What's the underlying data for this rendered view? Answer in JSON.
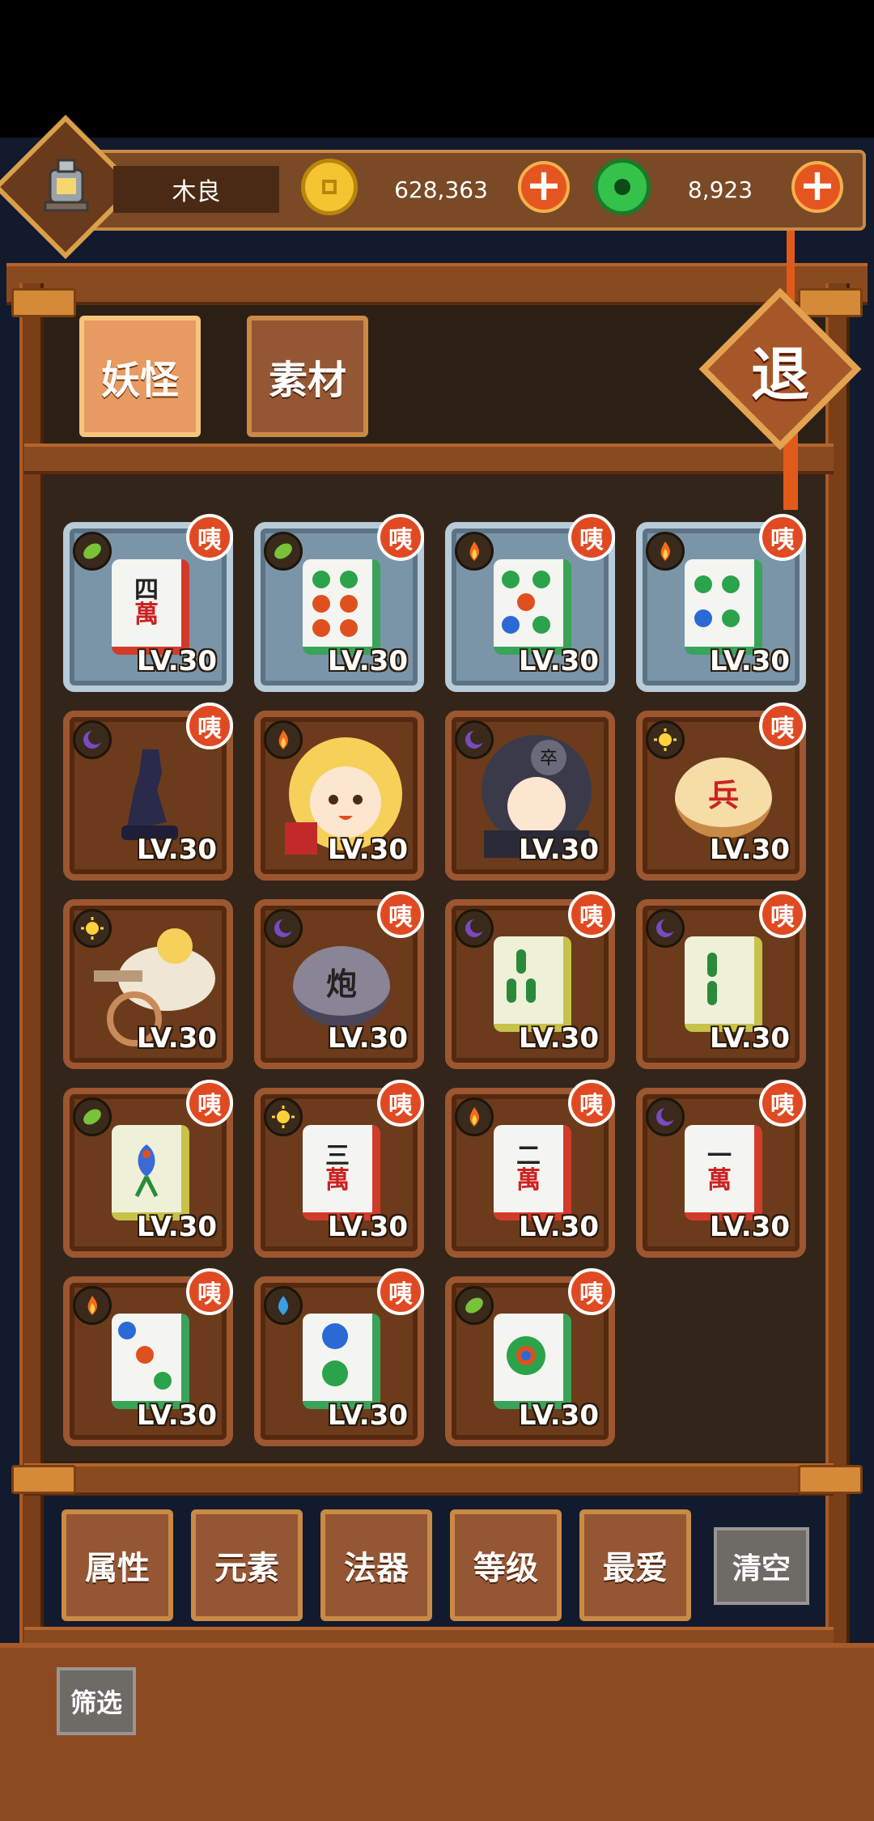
{
  "player": {
    "name": "木良"
  },
  "currency": {
    "coins": "628,363",
    "jade": "8,923"
  },
  "tabs": [
    {
      "label": "妖怪",
      "active": true
    },
    {
      "label": "素材",
      "active": false
    }
  ],
  "exit_label": "退",
  "cards": [
    {
      "level": "LV.30",
      "badge": "咦",
      "element": "leaf",
      "frame": "steel",
      "content": "mahjong-4-wan"
    },
    {
      "level": "LV.30",
      "badge": "咦",
      "element": "leaf",
      "frame": "steel",
      "content": "mahjong-6-dot"
    },
    {
      "level": "LV.30",
      "badge": "咦",
      "element": "fire",
      "frame": "steel",
      "content": "mahjong-5-dot"
    },
    {
      "level": "LV.30",
      "badge": "咦",
      "element": "fire",
      "frame": "steel",
      "content": "mahjong-4-dot"
    },
    {
      "level": "LV.30",
      "badge": "咦",
      "element": "moon",
      "frame": "wood",
      "content": "chess-knight"
    },
    {
      "level": "LV.30",
      "badge": "",
      "element": "fire",
      "frame": "wood",
      "content": "blonde-girl"
    },
    {
      "level": "LV.30",
      "badge": "",
      "element": "moon",
      "frame": "wood",
      "content": "dark-warrior"
    },
    {
      "level": "LV.30",
      "badge": "咦",
      "element": "sun",
      "frame": "wood",
      "content": "xiangqi-bing"
    },
    {
      "level": "LV.30",
      "badge": "",
      "element": "sun",
      "frame": "wood",
      "content": "cannon-boy"
    },
    {
      "level": "LV.30",
      "badge": "咦",
      "element": "moon",
      "frame": "wood",
      "content": "xiangqi-pao"
    },
    {
      "level": "LV.30",
      "badge": "咦",
      "element": "moon",
      "frame": "wood",
      "content": "mahjong-3-bamboo"
    },
    {
      "level": "LV.30",
      "badge": "咦",
      "element": "moon",
      "frame": "wood",
      "content": "mahjong-2-bamboo"
    },
    {
      "level": "LV.30",
      "badge": "咦",
      "element": "leaf",
      "frame": "wood",
      "content": "mahjong-1-bamboo"
    },
    {
      "level": "LV.30",
      "badge": "咦",
      "element": "sun",
      "frame": "wood",
      "content": "mahjong-3-wan"
    },
    {
      "level": "LV.30",
      "badge": "咦",
      "element": "fire",
      "frame": "wood",
      "content": "mahjong-2-wan"
    },
    {
      "level": "LV.30",
      "badge": "咦",
      "element": "moon",
      "frame": "wood",
      "content": "mahjong-1-wan"
    },
    {
      "level": "LV.30",
      "badge": "咦",
      "element": "fire",
      "frame": "wood",
      "content": "mahjong-3-dot"
    },
    {
      "level": "LV.30",
      "badge": "咦",
      "element": "water",
      "frame": "wood",
      "content": "mahjong-2-dot"
    },
    {
      "level": "LV.30",
      "badge": "咦",
      "element": "leaf",
      "frame": "wood",
      "content": "mahjong-1-dot"
    }
  ],
  "tile_text": {
    "si": "四",
    "san": "三",
    "er": "二",
    "yi": "一",
    "wan": "萬",
    "bing": "兵",
    "pao": "炮",
    "zu": "卒"
  },
  "filters": [
    "属性",
    "元素",
    "法器",
    "等级",
    "最爱"
  ],
  "clear_label": "清空",
  "filter_label": "筛选",
  "colors": {
    "wood": "#6b3b1c",
    "steel": "#7b95a8",
    "badge": "#e04a22",
    "accent": "#e79a62"
  }
}
